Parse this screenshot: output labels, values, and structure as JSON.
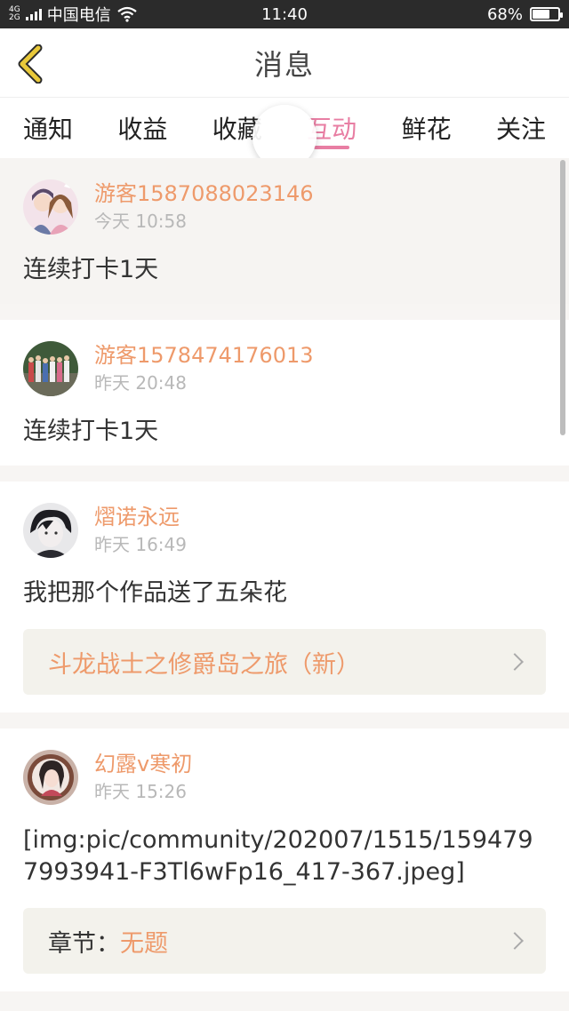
{
  "status_bar": {
    "network_top": "4G",
    "network_bottom": "2G",
    "carrier": "中国电信",
    "time": "11:40",
    "battery": "68%",
    "battery_level": 0.68
  },
  "header": {
    "title": "消息"
  },
  "tabs": [
    {
      "label": "通知"
    },
    {
      "label": "收益"
    },
    {
      "label": "收藏"
    },
    {
      "label": "互动",
      "active": true
    },
    {
      "label": "鲜花"
    },
    {
      "label": "关注"
    }
  ],
  "messages": [
    {
      "user": "游客1587088023146",
      "time": "今天 10:58",
      "text": "连续打卡1天"
    },
    {
      "user": "游客1578474176013",
      "time": "昨天 20:48",
      "text": "连续打卡1天"
    },
    {
      "user": "熠诺永远",
      "time": "昨天 16:49",
      "text": "我把那个作品送了五朵花",
      "link": "斗龙战士之修爵岛之旅（新）"
    },
    {
      "user": "幻露v寒初",
      "time": "昨天 15:26",
      "text": "[img:pic/community/202007/1515/1594797993941-F3Tl6wFp16_417-367.jpeg]",
      "link_label": "章节：",
      "link_value": "无题"
    }
  ],
  "colors": {
    "accent": "#e87ea3",
    "username": "#ee9a6b",
    "back_icon": "#e9c93a"
  },
  "icons": {
    "back": "chevron-left-icon",
    "wifi": "wifi-icon",
    "battery": "battery-icon",
    "arrow": "chevron-right-icon"
  }
}
